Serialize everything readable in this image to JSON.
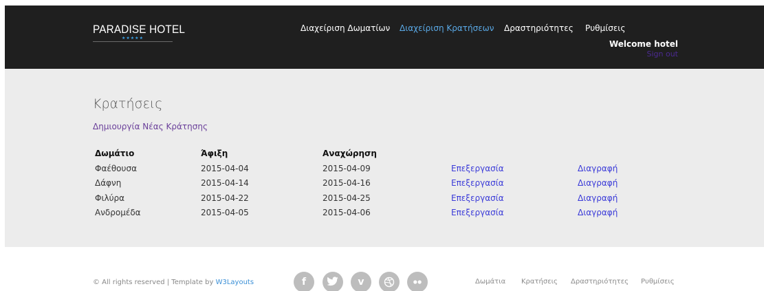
{
  "brand": {
    "name": "PARADISE HOTEL",
    "stars": "★★★★★"
  },
  "nav": {
    "items": [
      {
        "label": "Διαχείριση Δωματίων",
        "active": false
      },
      {
        "label": "Διαχείριση Κρατήσεων",
        "active": true
      },
      {
        "label": "Δραστηριότητες",
        "active": false
      },
      {
        "label": "Ρυθμίσεις",
        "active": false
      }
    ]
  },
  "user": {
    "welcome": "Welcome hotel",
    "signout": "Sign out"
  },
  "main": {
    "title": "Κρατήσεις",
    "create_link": "Δημιουργία Νέας Κράτησης",
    "table": {
      "headers": [
        "Δωμάτιο",
        "Άφιξη",
        "Αναχώρηση"
      ],
      "edit_label": "Επεξεργασία",
      "delete_label": "Διαγραφή",
      "rows": [
        {
          "room": "Φαέθουσα",
          "arrival": "2015-04-04",
          "departure": "2015-04-09"
        },
        {
          "room": "Δάφνη",
          "arrival": "2015-04-14",
          "departure": "2015-04-16"
        },
        {
          "room": "Φιλύρα",
          "arrival": "2015-04-22",
          "departure": "2015-04-25"
        },
        {
          "room": "Ανδρομέδα",
          "arrival": "2015-04-05",
          "departure": "2015-04-06"
        }
      ]
    }
  },
  "footer": {
    "copyright": "© All rights reserved | Template by",
    "credit_link": "W3Layouts",
    "social": [
      {
        "icon": "facebook-icon",
        "glyph": "f"
      },
      {
        "icon": "twitter-icon",
        "glyph": ""
      },
      {
        "icon": "vimeo-icon",
        "glyph": "v"
      },
      {
        "icon": "dribbble-icon",
        "glyph": ""
      },
      {
        "icon": "flickr-icon",
        "glyph": ""
      }
    ],
    "nav": [
      "Δωμάτια",
      "Κρατήσεις",
      "Δραστηριότητες",
      "Ρυθμίσεις"
    ]
  },
  "colors": {
    "header_bg": "#1f1f1f",
    "main_bg": "#ececec",
    "nav_active": "#5aa9e6",
    "link_blue": "#3a3ad8",
    "link_purple": "#6a3f9a",
    "social_bg": "#bdbdbd"
  }
}
